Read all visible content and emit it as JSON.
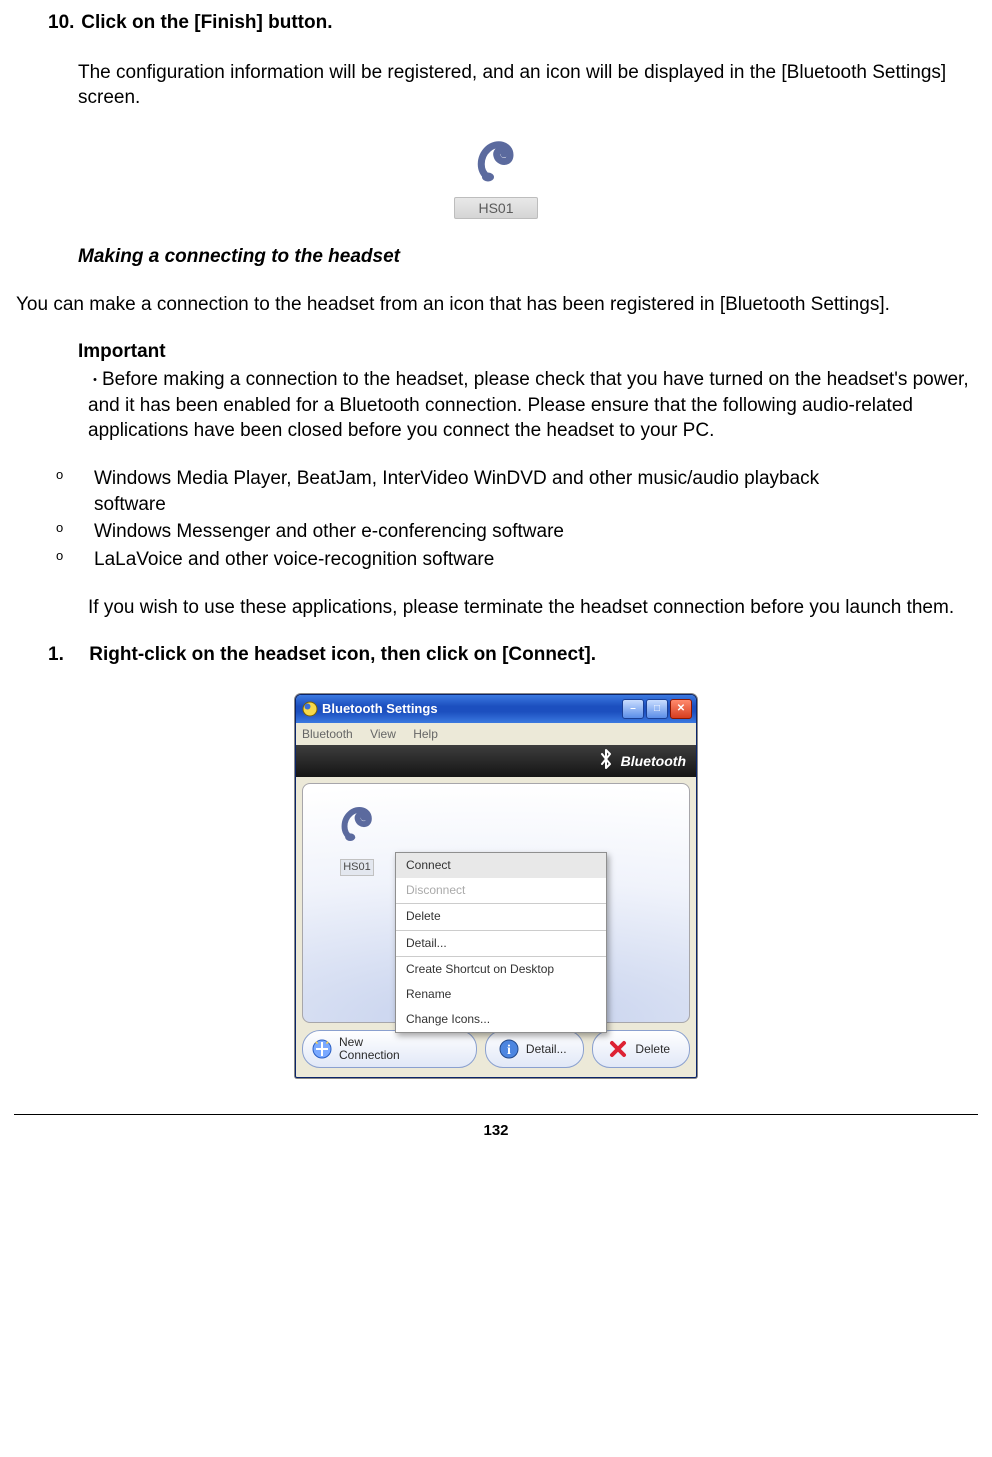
{
  "step10": {
    "number": "10.",
    "heading": "Click on the [Finish] button.",
    "body": "The configuration information will be registered, and an icon will be displayed in the [Bluetooth Settings] screen."
  },
  "hs_icon": {
    "label": "HS01"
  },
  "section_heading": "Making a connecting to the headset",
  "section_body": "You can make a connection to the headset from an icon that has been registered in [Bluetooth Settings].",
  "important": {
    "heading": "Important",
    "body": "Before making a connection to the headset, please check that you have turned on the headset's power, and it has been enabled for a Bluetooth connection. Please ensure that the following audio-related applications have been closed before you connect the headset to your PC.",
    "items": [
      "Windows Media Player, BeatJam, InterVideo WinDVD and other music/audio playback software",
      "Windows Messenger and other e-conferencing software",
      "LaLaVoice and other voice-recognition software"
    ],
    "after": "If you wish to use these applications, please terminate the headset connection before you launch them."
  },
  "step1": {
    "number": "1.",
    "text": "Right-click on the headset icon, then click on [Connect]."
  },
  "window": {
    "title": "Bluetooth Settings",
    "menus": [
      "Bluetooth",
      "View",
      "Help"
    ],
    "banner": "Bluetooth",
    "device_label": "HS01",
    "context_menu": {
      "connect": "Connect",
      "disconnect": "Disconnect",
      "delete": "Delete",
      "detail": "Detail...",
      "shortcut": "Create Shortcut on Desktop",
      "rename": "Rename",
      "change_icons": "Change Icons..."
    },
    "buttons": {
      "new_connection_line1": "New",
      "new_connection_line2": "Connection",
      "detail": "Detail...",
      "delete": "Delete"
    }
  },
  "page_number": "132"
}
